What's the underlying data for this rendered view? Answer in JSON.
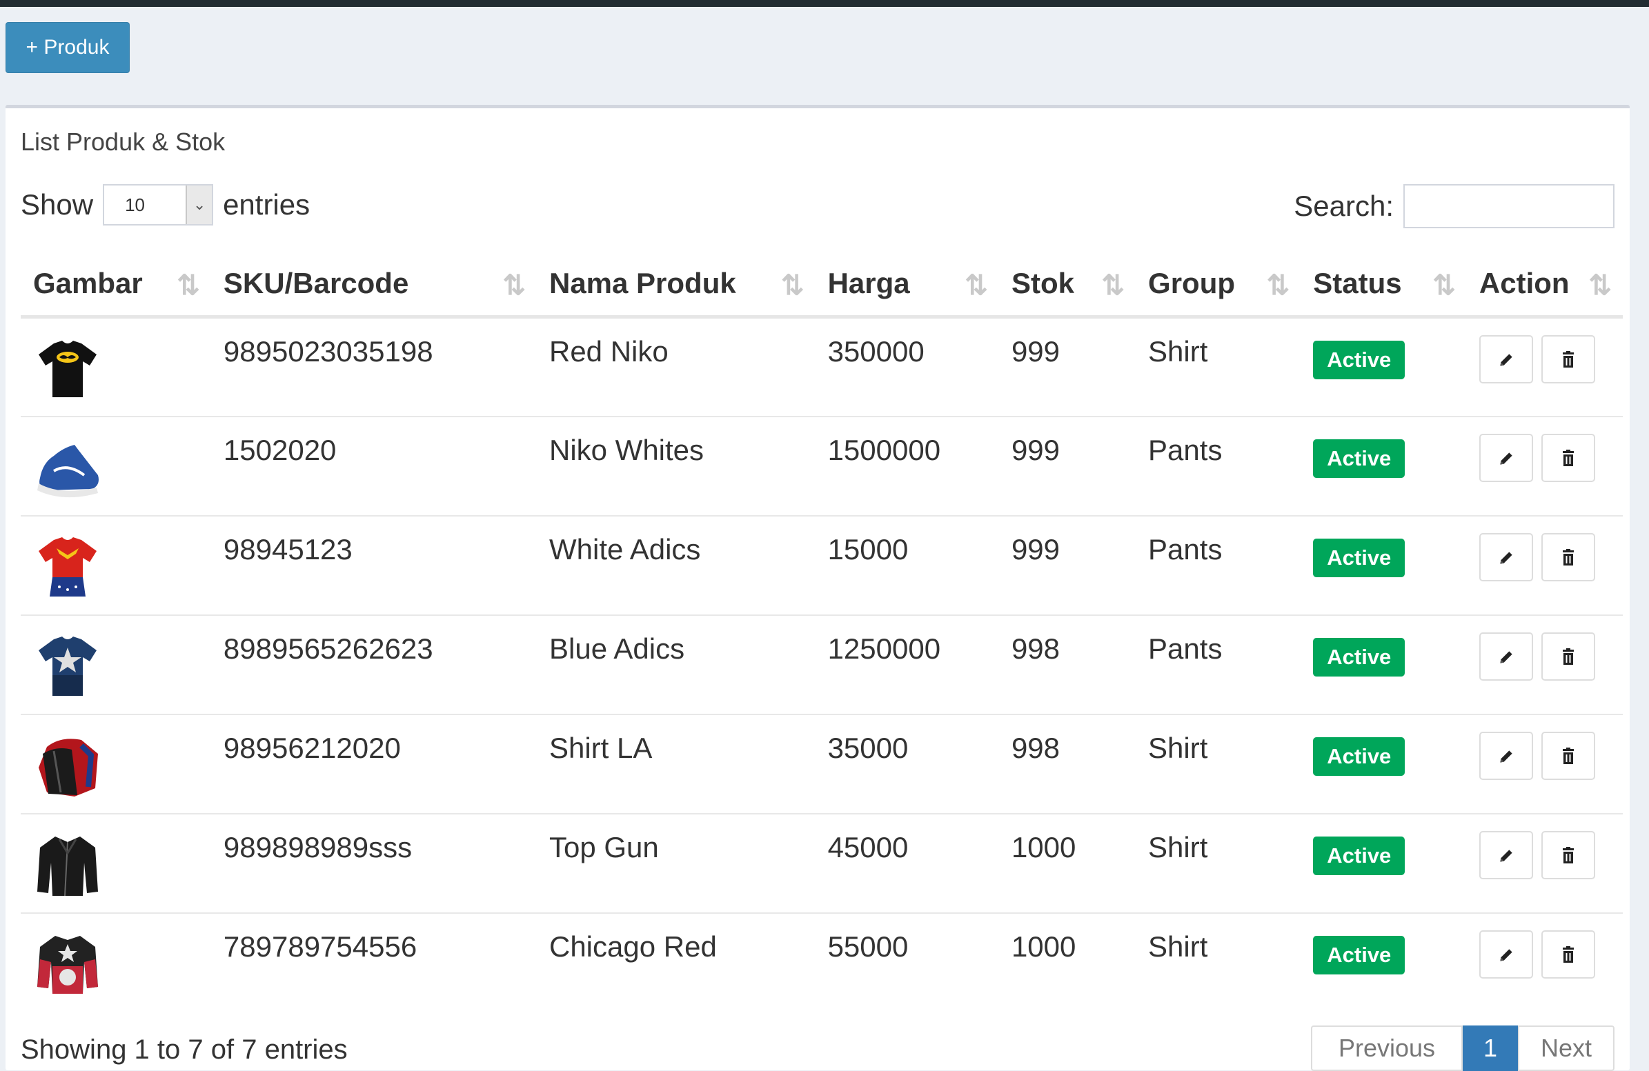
{
  "toolbar": {
    "add_label": "+ Produk"
  },
  "panel": {
    "title": "List Produk & Stok"
  },
  "length_menu": {
    "show_label": "Show",
    "value": "10",
    "entries_label": "entries"
  },
  "search": {
    "label": "Search:",
    "value": ""
  },
  "table": {
    "columns": [
      "Gambar",
      "SKU/Barcode",
      "Nama Produk",
      "Harga",
      "Stok",
      "Group",
      "Status",
      "Action"
    ],
    "rows": [
      {
        "image": "black-batman-tshirt",
        "sku": "9895023035198",
        "name": "Red Niko",
        "price": "350000",
        "stock": "999",
        "group": "Shirt",
        "status": "Active"
      },
      {
        "image": "blue-sneaker",
        "sku": "1502020",
        "name": "Niko Whites",
        "price": "1500000",
        "stock": "999",
        "group": "Pants",
        "status": "Active"
      },
      {
        "image": "red-wonder-shirt",
        "sku": "98945123",
        "name": "White Adics",
        "price": "15000",
        "stock": "999",
        "group": "Pants",
        "status": "Active"
      },
      {
        "image": "blue-star-shirt",
        "sku": "8989565262623",
        "name": "Blue Adics",
        "price": "1250000",
        "stock": "998",
        "group": "Pants",
        "status": "Active"
      },
      {
        "image": "red-jackets",
        "sku": "98956212020",
        "name": "Shirt LA",
        "price": "35000",
        "stock": "998",
        "group": "Shirt",
        "status": "Active"
      },
      {
        "image": "black-leather-jacket",
        "sku": "989898989sss",
        "name": "Top Gun",
        "price": "45000",
        "stock": "1000",
        "group": "Shirt",
        "status": "Active"
      },
      {
        "image": "star-jacket",
        "sku": "789789754556",
        "name": "Chicago Red",
        "price": "55000",
        "stock": "1000",
        "group": "Shirt",
        "status": "Active"
      }
    ]
  },
  "footer": {
    "info": "Showing 1 to 7 of 7 entries",
    "prev_label": "Previous",
    "current_page": "1",
    "next_label": "Next"
  },
  "colors": {
    "primary": "#3c8dbc",
    "success": "#00a65a",
    "page_bg": "#ecf0f5"
  }
}
